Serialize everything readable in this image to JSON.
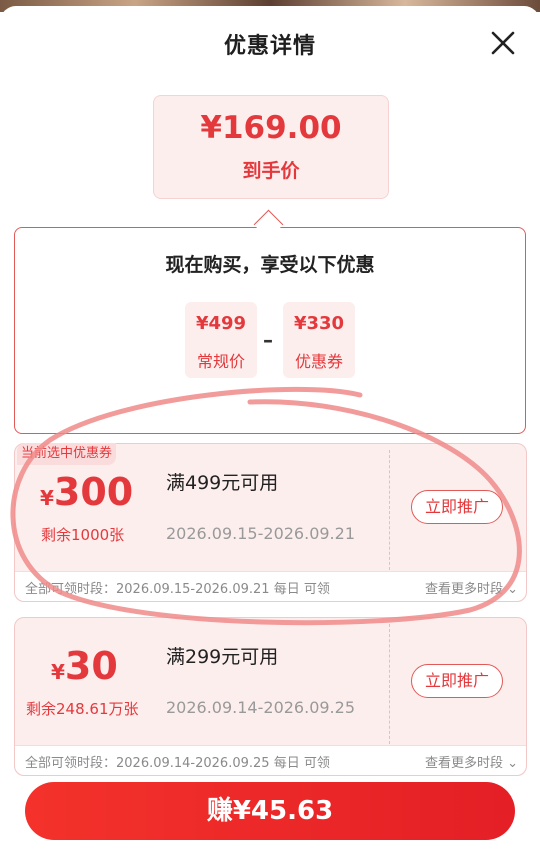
{
  "header": {
    "title": "优惠详情",
    "close_icon": "close-icon"
  },
  "final": {
    "price": "¥169.00",
    "label": "到手价"
  },
  "promo": {
    "title": "现在购买，享受以下优惠",
    "regular": {
      "price": "¥499",
      "label": "常规价"
    },
    "operator": "–",
    "coupon": {
      "price": "¥330",
      "label": "优惠券"
    }
  },
  "coupons": [
    {
      "badge": "当前选中优惠券",
      "yen": "¥",
      "amount": "300",
      "remain": "剩余1000张",
      "condition": "满499元可用",
      "dates": "2026.09.15-2026.09.21",
      "button": "立即推广",
      "footer_left": "全部可领时段：2026.09.15-2026.09.21 每日 可领",
      "footer_right": "查看更多时段",
      "selected": true
    },
    {
      "yen": "¥",
      "amount": "30",
      "remain": "剩余248.61万张",
      "condition": "满299元可用",
      "dates": "2026.09.14-2026.09.25",
      "button": "立即推广",
      "footer_left": "全部可领时段：2026.09.14-2026.09.25 每日 可领",
      "footer_right": "查看更多时段",
      "selected": false
    }
  ],
  "cta": {
    "label": "赚¥45.63"
  },
  "colors": {
    "accent": "#e4393c",
    "pale": "#fdeeee",
    "annotation": "#f08a8a"
  }
}
